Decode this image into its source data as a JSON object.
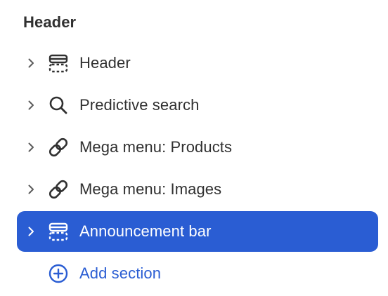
{
  "section_group": {
    "title": "Header",
    "items": [
      {
        "label": "Header",
        "icon": "section-layout-icon",
        "selected": false
      },
      {
        "label": "Predictive search",
        "icon": "search-icon",
        "selected": false
      },
      {
        "label": "Mega menu: Products",
        "icon": "link-icon",
        "selected": false
      },
      {
        "label": "Mega menu: Images",
        "icon": "link-icon",
        "selected": false
      },
      {
        "label": "Announcement bar",
        "icon": "section-layout-icon",
        "selected": true
      }
    ],
    "add_label": "Add section",
    "add_icon": "plus-circle-icon"
  },
  "colors": {
    "text": "#303030",
    "accent": "#2a5dd3",
    "selected_text": "#ffffff"
  }
}
